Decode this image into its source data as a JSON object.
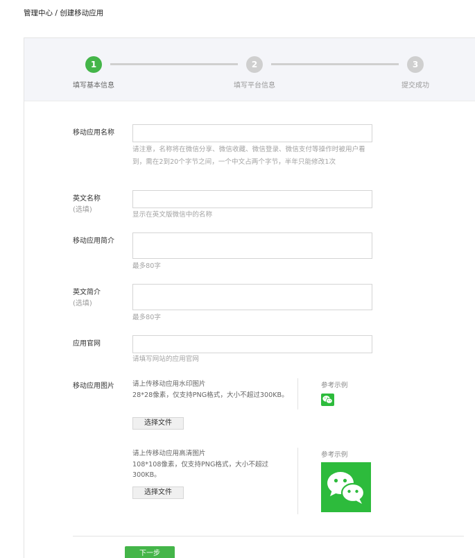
{
  "breadcrumb": {
    "text": "管理中心 / 创建移动应用"
  },
  "steps": [
    {
      "number": "1",
      "label": "填写基本信息",
      "state": "active"
    },
    {
      "number": "2",
      "label": "填写平台信息",
      "state": "todo"
    },
    {
      "number": "3",
      "label": "提交成功",
      "state": "todo"
    }
  ],
  "form": {
    "app_name": {
      "label": "移动应用名称",
      "value": "",
      "help": "请注意，名称将在微信分享、微信收藏、微信登录、微信支付等操作时被用户看到，需在2到20个字节之间，一个中文占两个字节，半年只能修改1次"
    },
    "english_name": {
      "label": "英文名称",
      "optional": "(选填)",
      "value": "",
      "help": "显示在英文版微信中的名称"
    },
    "app_intro": {
      "label": "移动应用简介",
      "value": "",
      "help": "最多80字"
    },
    "english_intro": {
      "label": "英文简介",
      "optional": "(选填)",
      "value": "",
      "help": "最多80字"
    },
    "website": {
      "label": "应用官网",
      "value": "",
      "help": "请填写网站的应用官网"
    },
    "images": {
      "label": "移动应用图片",
      "watermark": {
        "line1": "请上传移动应用水印图片",
        "line2": "28*28像素，仅支持PNG格式，大小不超过300KB。",
        "button": "选择文件",
        "ref_label": "参考示例"
      },
      "hd": {
        "line1": "请上传移动应用高清图片",
        "line2": "108*108像素，仅支持PNG格式，大小不超过300KB。",
        "button": "选择文件",
        "ref_label": "参考示例"
      }
    }
  },
  "actions": {
    "next": "下一步"
  },
  "colors": {
    "accent": "#44b549",
    "icon_green": "#2dbb3c",
    "step_inactive": "#cfcfcf"
  }
}
